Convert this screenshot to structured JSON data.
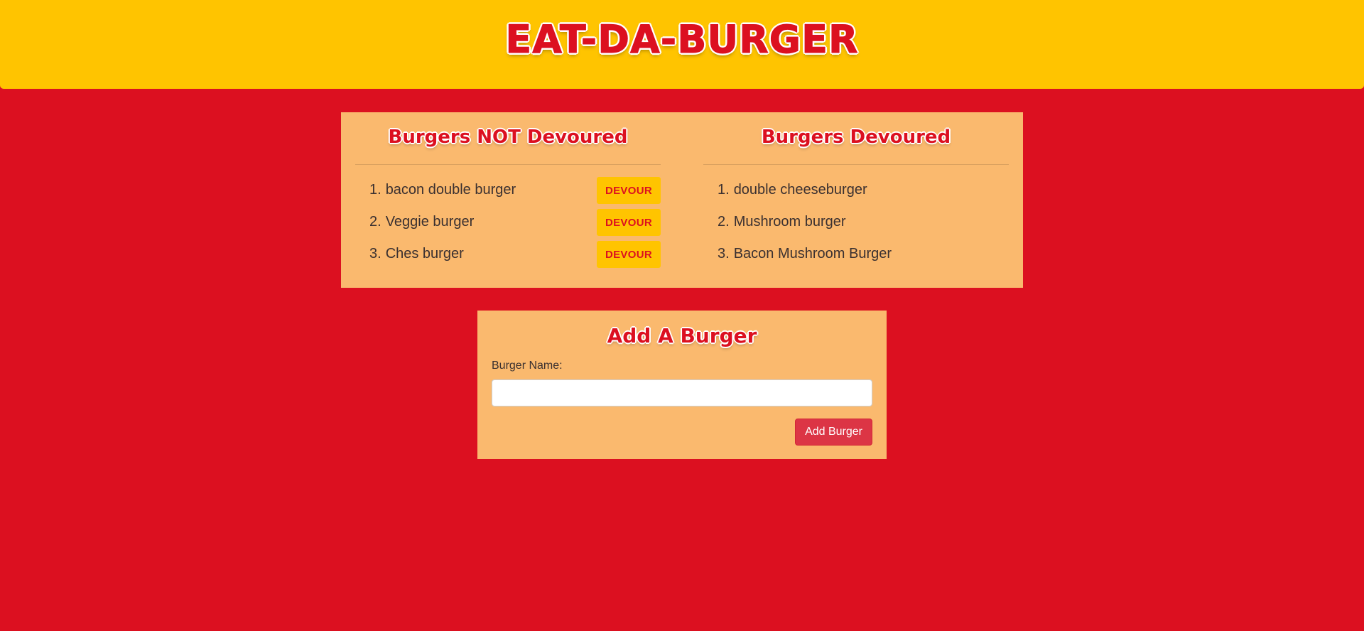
{
  "header": {
    "title": "EAT-DA-BURGER"
  },
  "not_devoured": {
    "heading": "Burgers NOT Devoured",
    "items": [
      {
        "num": "1.",
        "name": "bacon double burger",
        "button": "DEVOUR"
      },
      {
        "num": "2.",
        "name": "Veggie burger",
        "button": "DEVOUR"
      },
      {
        "num": "3.",
        "name": "Ches burger",
        "button": "DEVOUR"
      }
    ]
  },
  "devoured": {
    "heading": "Burgers Devoured",
    "items": [
      {
        "num": "1.",
        "name": "double cheeseburger"
      },
      {
        "num": "2.",
        "name": "Mushroom burger"
      },
      {
        "num": "3.",
        "name": "Bacon Mushroom Burger"
      }
    ]
  },
  "add_form": {
    "heading": "Add A Burger",
    "label": "Burger Name:",
    "input_value": "",
    "submit_label": "Add Burger"
  },
  "colors": {
    "background": "#dc1020",
    "header": "#ffc400",
    "panel": "#fab96e",
    "accent_red": "#dc1020",
    "button_red": "#dc3545"
  }
}
